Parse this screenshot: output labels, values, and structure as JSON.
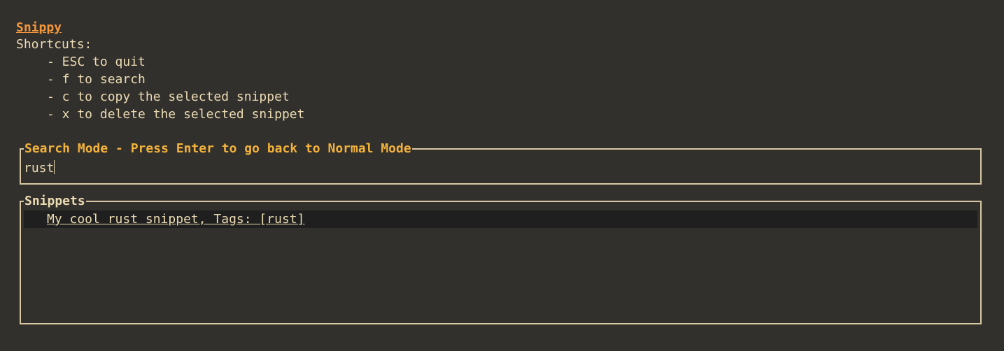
{
  "app": {
    "title": "Snippy"
  },
  "help": {
    "heading": "Shortcuts:",
    "items": [
      "- ESC to quit",
      "- f to search",
      "- c to copy the selected snippet",
      "- x to delete the selected snippet"
    ]
  },
  "search": {
    "title": "Search Mode - Press Enter to go back to Normal Mode",
    "value": "rust"
  },
  "snippets": {
    "title": "Snippets",
    "items": [
      {
        "label": "My cool rust snippet, Tags: [rust]",
        "selected": true
      }
    ]
  },
  "colors": {
    "background": "#32302d",
    "foreground": "#ebdbb2",
    "accent_title": "#f2963b",
    "accent_search": "#f2b23b",
    "border": "#d8c9a3",
    "selection": "#1f1f1f"
  }
}
